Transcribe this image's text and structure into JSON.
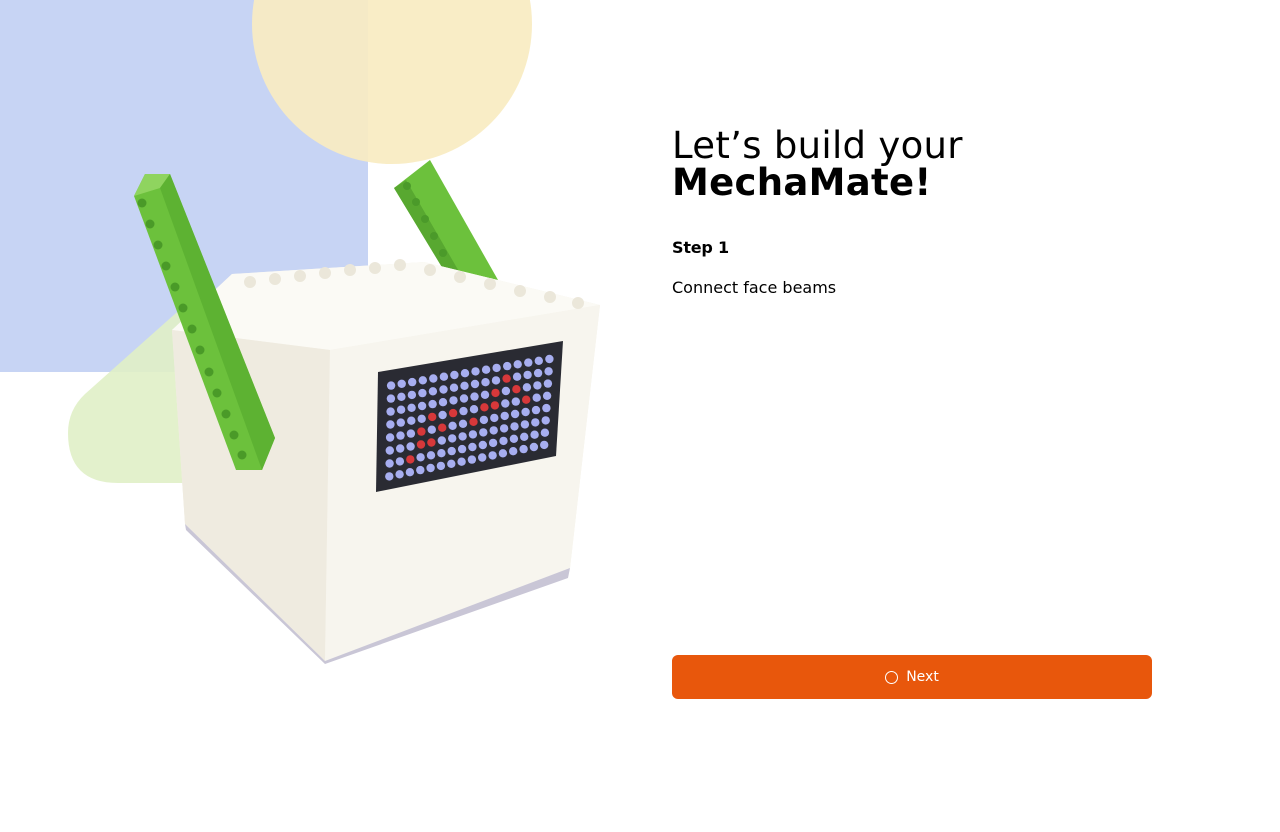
{
  "heading": {
    "line1": "Let’s build your",
    "line2": "MechaMate!"
  },
  "step": {
    "label": "Step 1",
    "description": "Connect face beams"
  },
  "actions": {
    "next_label": "Next",
    "next_icon": "loading-spinner-icon"
  },
  "colors": {
    "accent": "#e8570c",
    "shape_blue": "#c7d4f4",
    "shape_yellow": "#f8ebc1",
    "shape_green": "#e0f0c6",
    "beam_green": "#6cc13c",
    "cube_white": "#f6f3ea",
    "led_panel": "#2a2b33",
    "led_off": "#a7aef0",
    "led_on": "#d7383a"
  },
  "led_matrix": {
    "rows": 8,
    "cols": 16,
    "lit": [
      [
        6,
        2
      ],
      [
        4,
        3
      ],
      [
        5,
        3
      ],
      [
        3,
        4
      ],
      [
        5,
        4
      ],
      [
        4,
        5
      ],
      [
        3,
        6
      ],
      [
        4,
        8
      ],
      [
        3,
        9
      ],
      [
        2,
        10
      ],
      [
        3,
        10
      ],
      [
        1,
        11
      ],
      [
        2,
        12
      ],
      [
        3,
        13
      ]
    ]
  }
}
